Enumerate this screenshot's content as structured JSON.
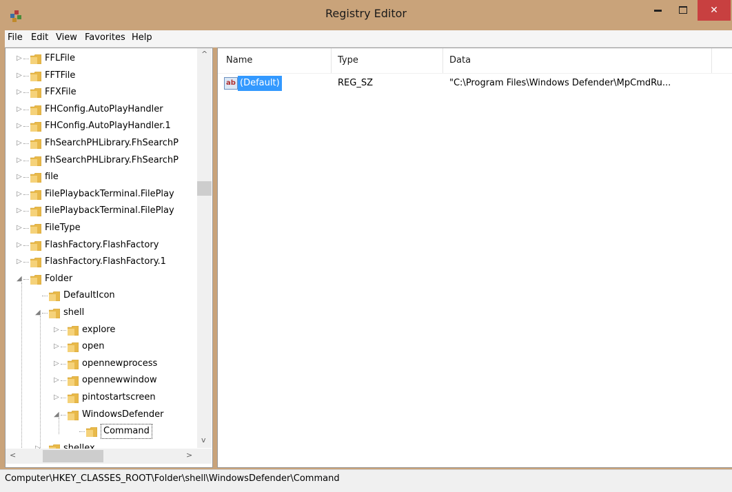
{
  "window": {
    "title": "Registry Editor",
    "close_glyph": "✕"
  },
  "menu": [
    "File",
    "Edit",
    "View",
    "Favorites",
    "Help"
  ],
  "tree": {
    "rows": [
      {
        "label": "FFLFile",
        "indent": 0,
        "expander": "▷"
      },
      {
        "label": "FFTFile",
        "indent": 0,
        "expander": "▷"
      },
      {
        "label": "FFXFile",
        "indent": 0,
        "expander": "▷"
      },
      {
        "label": "FHConfig.AutoPlayHandler",
        "indent": 0,
        "expander": "▷"
      },
      {
        "label": "FHConfig.AutoPlayHandler.1",
        "indent": 0,
        "expander": "▷"
      },
      {
        "label": "FhSearchPHLibrary.FhSearchP",
        "indent": 0,
        "expander": "▷"
      },
      {
        "label": "FhSearchPHLibrary.FhSearchP",
        "indent": 0,
        "expander": "▷"
      },
      {
        "label": "file",
        "indent": 0,
        "expander": "▷"
      },
      {
        "label": "FilePlaybackTerminal.FilePlay",
        "indent": 0,
        "expander": "▷"
      },
      {
        "label": "FilePlaybackTerminal.FilePlay",
        "indent": 0,
        "expander": "▷"
      },
      {
        "label": "FileType",
        "indent": 0,
        "expander": "▷"
      },
      {
        "label": "FlashFactory.FlashFactory",
        "indent": 0,
        "expander": "▷"
      },
      {
        "label": "FlashFactory.FlashFactory.1",
        "indent": 0,
        "expander": "▷"
      },
      {
        "label": "Folder",
        "indent": 0,
        "expander": "◢"
      },
      {
        "label": "DefaultIcon",
        "indent": 1,
        "expander": ""
      },
      {
        "label": "shell",
        "indent": 1,
        "expander": "◢"
      },
      {
        "label": "explore",
        "indent": 2,
        "expander": "▷"
      },
      {
        "label": "open",
        "indent": 2,
        "expander": "▷"
      },
      {
        "label": "opennewprocess",
        "indent": 2,
        "expander": "▷"
      },
      {
        "label": "opennewwindow",
        "indent": 2,
        "expander": "▷"
      },
      {
        "label": "pintostartscreen",
        "indent": 2,
        "expander": "▷"
      },
      {
        "label": "WindowsDefender",
        "indent": 2,
        "expander": "◢"
      },
      {
        "label": "Command",
        "indent": 3,
        "expander": "",
        "selected": true
      },
      {
        "label": "shellex",
        "indent": 1,
        "expander": "▷"
      }
    ],
    "scroll_up": "^",
    "scroll_down": "v",
    "scroll_left": "<",
    "scroll_right": ">"
  },
  "list": {
    "columns": [
      "Name",
      "Type",
      "Data"
    ],
    "rows": [
      {
        "icon": "string-value-icon",
        "icon_text": "ab",
        "name": "(Default)",
        "type": "REG_SZ",
        "data": "\"C:\\Program Files\\Windows Defender\\MpCmdRu..."
      }
    ]
  },
  "status": {
    "path": "Computer\\HKEY_CLASSES_ROOT\\Folder\\shell\\WindowsDefender\\Command"
  },
  "colors": {
    "titlebar": "#c9a37a",
    "close": "#c84040",
    "folder": "#e8b94a",
    "selection": "#3399ff"
  }
}
